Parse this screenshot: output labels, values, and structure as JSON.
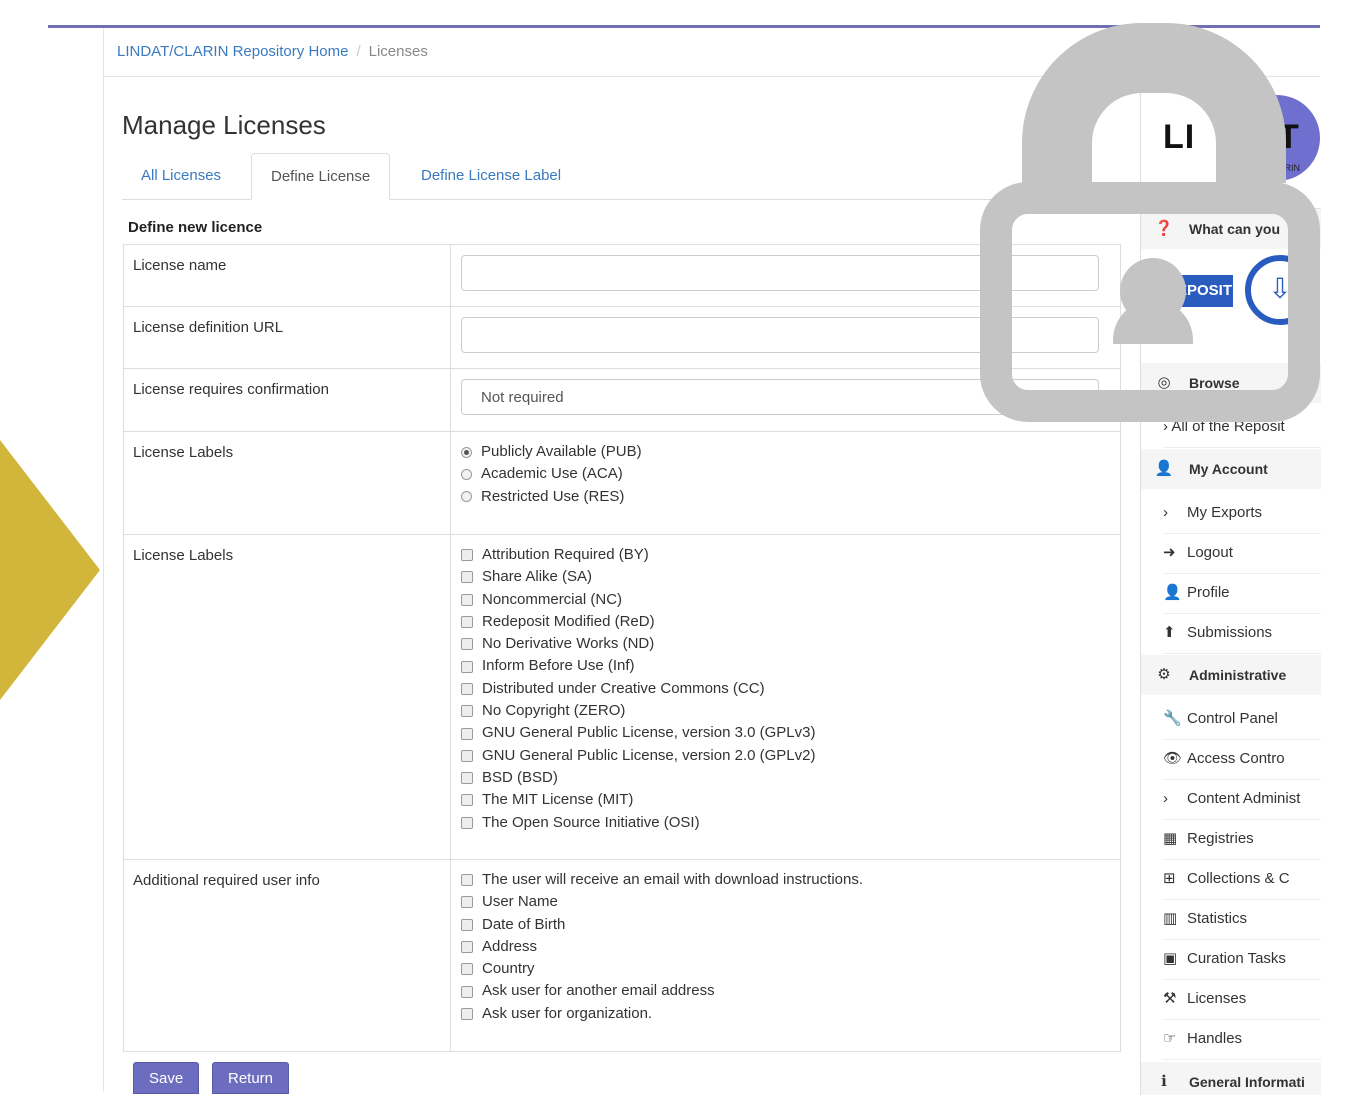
{
  "breadcrumb": {
    "home": "LINDAT/CLARIN Repository Home",
    "current": "Licenses"
  },
  "page_title": "Manage Licenses",
  "tabs": [
    {
      "label": "All Licenses"
    },
    {
      "label": "Define License"
    },
    {
      "label": "Define License Label"
    }
  ],
  "form": {
    "section_title": "Define new licence",
    "license_name_label": "License name",
    "license_url_label": "License definition URL",
    "confirmation_label": "License requires confirmation",
    "confirmation_value": "Not required",
    "labels_label": "License Labels",
    "radio_options": [
      "Publicly Available (PUB)",
      "Academic Use (ACA)",
      "Restricted Use (RES)"
    ],
    "extended_labels_label": "License Labels",
    "checkbox_options": [
      "Attribution Required (BY)",
      "Share Alike (SA)",
      "Noncommercial (NC)",
      "Redeposit Modified (ReD)",
      "No Derivative Works (ND)",
      "Inform Before Use (Inf)",
      "Distributed under Creative Commons (CC)",
      "No Copyright (ZERO)",
      "GNU General Public License, version 3.0 (GPLv3)",
      "GNU General Public License, version 2.0 (GPLv2)",
      "BSD (BSD)",
      "The MIT License (MIT)",
      "The Open Source Initiative (OSI)"
    ],
    "user_info_label": "Additional required user info",
    "user_info_options": [
      "The user will receive an email with download instructions.",
      "User Name",
      "Date of Birth",
      "Address",
      "Country",
      "Ask user for another email address",
      "Ask user for organization."
    ],
    "save": "Save",
    "return": "Return"
  },
  "sidebar": {
    "logo_text": "LINDAT",
    "logo_left": "LI",
    "logo_right": "AT",
    "logo_sub": "CLARIN",
    "what_can": "What can you",
    "deposit": "EPOSIT",
    "browse": "Browse",
    "browse_item": "› All of the Reposit",
    "my_account": "My Account",
    "account_items": [
      {
        "icon": "›",
        "label": "My Exports"
      },
      {
        "icon": "➜",
        "label": "Logout"
      },
      {
        "icon": "👤",
        "label": "Profile"
      },
      {
        "icon": "⬆",
        "label": "Submissions"
      }
    ],
    "administrative": "Administrative",
    "admin_items": [
      {
        "icon": "🔧",
        "label": "Control Panel"
      },
      {
        "icon": "👁",
        "label": "Access Contro"
      },
      {
        "icon": "›",
        "label": "Content Administ"
      },
      {
        "icon": "▦",
        "label": "Registries"
      },
      {
        "icon": "⊞",
        "label": "Collections & C"
      },
      {
        "icon": "▥",
        "label": "Statistics"
      },
      {
        "icon": "▣",
        "label": "Curation Tasks"
      },
      {
        "icon": "⚒",
        "label": "Licenses"
      },
      {
        "icon": "☞",
        "label": "Handles"
      }
    ],
    "general_info": "General Informati"
  },
  "colors": {
    "accent": "#6d6dc0",
    "link": "#3a7abf",
    "arrow": "#d2b63b",
    "lock": "#c4c4c4"
  }
}
